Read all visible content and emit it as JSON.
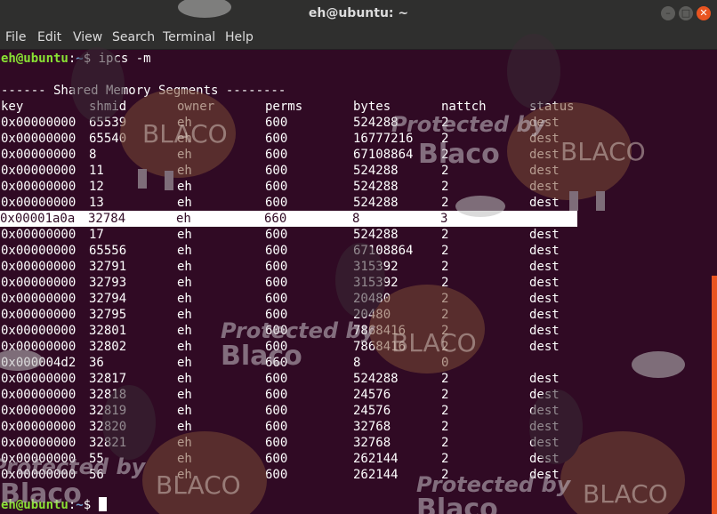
{
  "window": {
    "title": "eh@ubuntu: ~",
    "minimize": "–",
    "maximize": "□",
    "close": "✕"
  },
  "menu": [
    "File",
    "Edit",
    "View",
    "Search",
    "Terminal",
    "Help"
  ],
  "prompt": {
    "user": "eh@ubuntu",
    "colon": ":",
    "path": "~",
    "symbol": "$ "
  },
  "command": "ipcs -m",
  "section_header": "------ Shared Memory Segments --------",
  "columns": [
    "key",
    "shmid",
    "owner",
    "perms",
    "bytes",
    "nattch",
    "status"
  ],
  "rows": [
    [
      "0x00000000",
      "65539",
      "eh",
      "600",
      "524288",
      "2",
      "dest"
    ],
    [
      "0x00000000",
      "65540",
      "eh",
      "600",
      "16777216",
      "2",
      "dest"
    ],
    [
      "0x00000000",
      "8",
      "eh",
      "600",
      "67108864",
      "2",
      "dest"
    ],
    [
      "0x00000000",
      "11",
      "eh",
      "600",
      "524288",
      "2",
      "dest"
    ],
    [
      "0x00000000",
      "12",
      "eh",
      "600",
      "524288",
      "2",
      "dest"
    ],
    [
      "0x00000000",
      "13",
      "eh",
      "600",
      "524288",
      "2",
      "dest"
    ],
    [
      "0x00001a0a",
      "32784",
      "eh",
      "660",
      "8",
      "3",
      ""
    ],
    [
      "0x00000000",
      "17",
      "eh",
      "600",
      "524288",
      "2",
      "dest"
    ],
    [
      "0x00000000",
      "65556",
      "eh",
      "600",
      "67108864",
      "2",
      "dest"
    ],
    [
      "0x00000000",
      "32791",
      "eh",
      "600",
      "315392",
      "2",
      "dest"
    ],
    [
      "0x00000000",
      "32793",
      "eh",
      "600",
      "315392",
      "2",
      "dest"
    ],
    [
      "0x00000000",
      "32794",
      "eh",
      "600",
      "20480",
      "2",
      "dest"
    ],
    [
      "0x00000000",
      "32795",
      "eh",
      "600",
      "20480",
      "2",
      "dest"
    ],
    [
      "0x00000000",
      "32801",
      "eh",
      "600",
      "7868416",
      "2",
      "dest"
    ],
    [
      "0x00000000",
      "32802",
      "eh",
      "600",
      "7868416",
      "2",
      "dest"
    ],
    [
      "0x000004d2",
      "36",
      "eh",
      "660",
      "8",
      "0",
      ""
    ],
    [
      "0x00000000",
      "32817",
      "eh",
      "600",
      "524288",
      "2",
      "dest"
    ],
    [
      "0x00000000",
      "32818",
      "eh",
      "600",
      "24576",
      "2",
      "dest"
    ],
    [
      "0x00000000",
      "32819",
      "eh",
      "600",
      "24576",
      "2",
      "dest"
    ],
    [
      "0x00000000",
      "32820",
      "eh",
      "600",
      "32768",
      "2",
      "dest"
    ],
    [
      "0x00000000",
      "32821",
      "eh",
      "600",
      "32768",
      "2",
      "dest"
    ],
    [
      "0x00000000",
      "55",
      "eh",
      "600",
      "262144",
      "2",
      "dest"
    ],
    [
      "0x00000000",
      "56",
      "eh",
      "600",
      "262144",
      "2",
      "dest"
    ]
  ],
  "highlighted_row": 6,
  "watermark": {
    "protected": "Protected by",
    "brand": "Blaco",
    "logo": "BLACO",
    "face": "!!"
  }
}
